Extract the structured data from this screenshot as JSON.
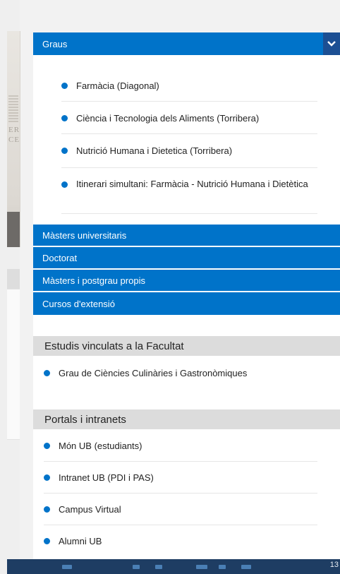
{
  "accordion": {
    "graus": {
      "label": "Graus",
      "items": [
        "Farmàcia (Diagonal)",
        "Ciència i Tecnologia dels Aliments (Torribera)",
        "Nutrició Humana i Dietetica (Torribera)",
        "Itinerari simultani: Farmàcia - Nutrició Humana i Dietètica"
      ]
    },
    "collapsed": [
      "Màsters universitaris",
      "Doctorat",
      "Màsters i postgrau propis",
      "Cursos d'extensió"
    ]
  },
  "estudis": {
    "title": "Estudis vinculats a la Facultat",
    "items": [
      "Grau de Ciències Culinàries i Gastronòmiques"
    ]
  },
  "portals": {
    "title": "Portals i intranets",
    "items": [
      "Món UB (estudiants)",
      "Intranet UB (PDI i PAS)",
      "Campus Virtual",
      "Alumni UB"
    ]
  },
  "background": {
    "crest_text": "ER\nCE"
  },
  "taskbar": {
    "clock": "13"
  },
  "colors": {
    "accent": "#0073c9",
    "accent_dark": "#1c4f93",
    "section_bg": "#dcdcdc"
  }
}
